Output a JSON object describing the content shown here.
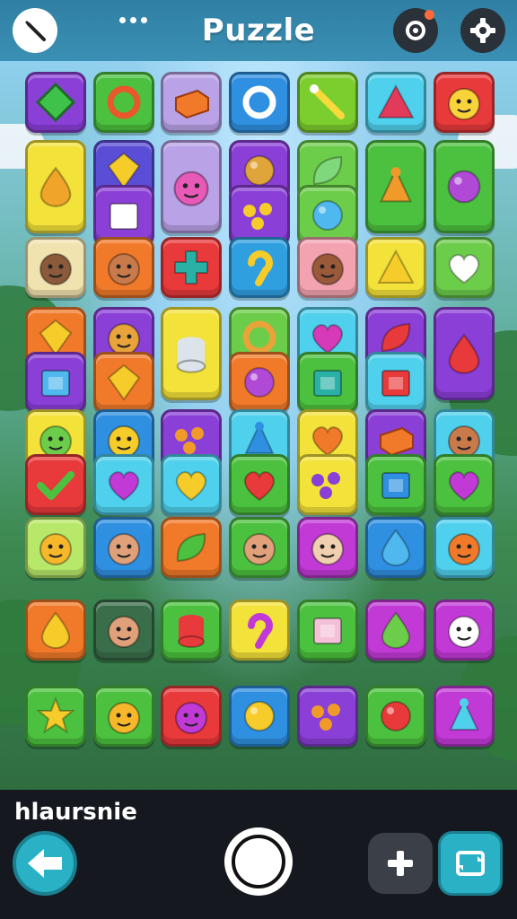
{
  "app": {
    "title": "Puzzle",
    "status_text": "hlaursnie"
  },
  "colors": {
    "topbar": "#3a90b4",
    "bottombar": "#15191f",
    "accent": "#2ab1c6"
  },
  "toolbar": {
    "back_icon": "wrench-icon",
    "menu_icon": "dots-icon",
    "badge_icon": "gear-badge-icon",
    "settings_icon": "gear-icon"
  },
  "controls": {
    "back_icon": "arrow-left-icon",
    "center_icon": "circle-icon",
    "add_icon": "plus-icon",
    "shuffle_icon": "shuffle-icon"
  },
  "tiles": [
    {
      "name": "kite-tile",
      "color": "#8a3fd6",
      "icon": "kite",
      "fg": "#3fc24a"
    },
    {
      "name": "ring-tile",
      "color": "#4cc13f",
      "icon": "ring",
      "fg": "#e8582a"
    },
    {
      "name": "brick-tile",
      "color": "#b9a2e6",
      "icon": "brick",
      "fg": "#f07a2a"
    },
    {
      "name": "magnifier-tile",
      "color": "#2f8fe0",
      "icon": "ring",
      "fg": "#ffffff"
    },
    {
      "name": "wand-tile",
      "color": "#7ccd2e",
      "icon": "wand",
      "fg": "#f6d93a"
    },
    {
      "name": "pyramid-tile",
      "color": "#4fd0ec",
      "icon": "triangle",
      "fg": "#e23a5a"
    },
    {
      "name": "bear-tile",
      "color": "#e8393b",
      "icon": "face",
      "fg": "#f9d33a"
    },
    {
      "name": "squid-tile",
      "color": "#f3e23a",
      "icon": "drop",
      "fg": "#f0a52a"
    },
    {
      "name": "gem-tile",
      "color": "#5a4ed6",
      "icon": "diamond",
      "fg": "#f6cc2a"
    },
    {
      "name": "cube-tile",
      "color": "#8a3fd6",
      "icon": "cube",
      "fg": "#ffffff"
    },
    {
      "name": "cat-tile",
      "color": "#b9a2e6",
      "icon": "face",
      "fg": "#e85ab8"
    },
    {
      "name": "cookie-tile",
      "color": "#8a3fd6",
      "icon": "circle",
      "fg": "#e0a53a"
    },
    {
      "name": "rings-tile",
      "color": "#8a3fd6",
      "icon": "dots",
      "fg": "#f6cc2a"
    },
    {
      "name": "leaf-tile",
      "color": "#6ccd4a",
      "icon": "leaf",
      "fg": "#7fd87a"
    },
    {
      "name": "balloon-tile",
      "color": "#6ccd4a",
      "icon": "circle",
      "fg": "#4fb8ee"
    },
    {
      "name": "rocket-tile",
      "color": "#4cc13f",
      "icon": "cone",
      "fg": "#f09a2a"
    },
    {
      "name": "lollipop-tile",
      "color": "#4cc13f",
      "icon": "circle",
      "fg": "#b04ad6"
    },
    {
      "name": "hat-face-tile",
      "color": "#f1e3b0",
      "icon": "face",
      "fg": "#8a5a3a"
    },
    {
      "name": "boy-face-tile",
      "color": "#f07a2a",
      "icon": "face",
      "fg": "#c97a4a"
    },
    {
      "name": "cross-tile",
      "color": "#e8393b",
      "icon": "cross",
      "fg": "#2ab1a6"
    },
    {
      "name": "hook-tile",
      "color": "#2f9fe0",
      "icon": "hook",
      "fg": "#f6cc2a"
    },
    {
      "name": "girl-face-tile",
      "color": "#f3a3b0",
      "icon": "face",
      "fg": "#9a5a3a"
    },
    {
      "name": "cheese-tile",
      "color": "#f3e23a",
      "icon": "triangle",
      "fg": "#f6cc2a"
    },
    {
      "name": "heart-white-tile",
      "color": "#6ccd4a",
      "icon": "heart",
      "fg": "#ffffff"
    },
    {
      "name": "gold-gem-tile",
      "color": "#f07a2a",
      "icon": "diamond",
      "fg": "#f6cc2a"
    },
    {
      "name": "mask-tile",
      "color": "#8a3fd6",
      "icon": "face",
      "fg": "#e8a33a"
    },
    {
      "name": "paper-tile",
      "color": "#f3e23a",
      "icon": "cylinder",
      "fg": "#dde3ea"
    },
    {
      "name": "swirl-tile",
      "color": "#6ccd4a",
      "icon": "ring",
      "fg": "#e8a33a"
    },
    {
      "name": "apple-tile",
      "color": "#4fd0ec",
      "icon": "heart",
      "fg": "#d63ab8"
    },
    {
      "name": "leaves-tile",
      "color": "#8a3fd6",
      "icon": "leaf",
      "fg": "#e8393b"
    },
    {
      "name": "chili-tile",
      "color": "#8a3fd6",
      "icon": "drop",
      "fg": "#e8393b"
    },
    {
      "name": "box-tile",
      "color": "#8a3fd6",
      "icon": "cube",
      "fg": "#4fb8ee"
    },
    {
      "name": "waffle-tile",
      "color": "#f07a2a",
      "icon": "diamond",
      "fg": "#f6cc2a"
    },
    {
      "name": "eggplant-tile",
      "color": "#f07a2a",
      "icon": "circle",
      "fg": "#b04ad6"
    },
    {
      "name": "crate-tile",
      "color": "#4cc13f",
      "icon": "cube",
      "fg": "#2ab1a6"
    },
    {
      "name": "red-box-tile",
      "color": "#4fd0ec",
      "icon": "cube",
      "fg": "#e8393b"
    },
    {
      "name": "frog-tile",
      "color": "#f3e23a",
      "icon": "face",
      "fg": "#6ccd4a"
    },
    {
      "name": "hat-kid-tile",
      "color": "#2f8fe0",
      "icon": "face",
      "fg": "#f6cc2a"
    },
    {
      "name": "berries-tile",
      "color": "#8a3fd6",
      "icon": "dots",
      "fg": "#f09a2a"
    },
    {
      "name": "bell-tile",
      "color": "#4fd0ec",
      "icon": "cone",
      "fg": "#2f8fe0"
    },
    {
      "name": "orange-heart-tile",
      "color": "#f3e23a",
      "icon": "heart",
      "fg": "#f07a2a"
    },
    {
      "name": "block-tile",
      "color": "#8a3fd6",
      "icon": "brick",
      "fg": "#f07a2a"
    },
    {
      "name": "beret-tile",
      "color": "#4fd0ec",
      "icon": "face",
      "fg": "#c97a4a"
    },
    {
      "name": "check-tile",
      "color": "#e8393b",
      "icon": "check",
      "fg": "#4cc13f"
    },
    {
      "name": "purple-heart-tile",
      "color": "#4fd0ec",
      "icon": "heart",
      "fg": "#c23ad6"
    },
    {
      "name": "yellow-heart-tile",
      "color": "#4fd0ec",
      "icon": "heart",
      "fg": "#f6cc2a"
    },
    {
      "name": "red-heart-tile",
      "color": "#4cc13f",
      "icon": "heart",
      "fg": "#e8393b"
    },
    {
      "name": "scissors-tile",
      "color": "#f3e23a",
      "icon": "dots",
      "fg": "#8a3fd6"
    },
    {
      "name": "tag-tile",
      "color": "#4cc13f",
      "icon": "cube",
      "fg": "#2f8fe0"
    },
    {
      "name": "violet-heart-tile",
      "color": "#4cc13f",
      "icon": "heart",
      "fg": "#c23ad6"
    },
    {
      "name": "sun-face-tile",
      "color": "#b8e86a",
      "icon": "face",
      "fg": "#f6b82a"
    },
    {
      "name": "cap-boy-tile",
      "color": "#2f8fe0",
      "icon": "face",
      "fg": "#e0a07a"
    },
    {
      "name": "pepper-tile",
      "color": "#f07a2a",
      "icon": "leaf",
      "fg": "#4cc13f"
    },
    {
      "name": "green-cap-tile",
      "color": "#4cc13f",
      "icon": "face",
      "fg": "#e0a07a"
    },
    {
      "name": "red-hat-tile",
      "color": "#c23ad6",
      "icon": "face",
      "fg": "#f1d0b0"
    },
    {
      "name": "blue-drop-tile",
      "color": "#2f8fe0",
      "icon": "drop",
      "fg": "#4fb8ee"
    },
    {
      "name": "pumpkin-tile",
      "color": "#4fd0ec",
      "icon": "face",
      "fg": "#f07a2a"
    },
    {
      "name": "fire-tile",
      "color": "#f07a2a",
      "icon": "drop",
      "fg": "#f6cc2a"
    },
    {
      "name": "purple-cap-tile",
      "color": "#3a6e4a",
      "icon": "face",
      "fg": "#e0a07a"
    },
    {
      "name": "lantern-tile",
      "color": "#4cc13f",
      "icon": "cylinder",
      "fg": "#e8393b"
    },
    {
      "name": "purple-hook-tile",
      "color": "#f3e23a",
      "icon": "hook",
      "fg": "#c23ad6"
    },
    {
      "name": "house-tile",
      "color": "#4cc13f",
      "icon": "cube",
      "fg": "#f3c0d8"
    },
    {
      "name": "pear-tile",
      "color": "#c23ad6",
      "icon": "drop",
      "fg": "#6ccd4a"
    },
    {
      "name": "ghost-tile",
      "color": "#c23ad6",
      "icon": "face",
      "fg": "#ffffff"
    },
    {
      "name": "star-tile",
      "color": "#4cc13f",
      "icon": "star",
      "fg": "#f6cc2a"
    },
    {
      "name": "fox-tile",
      "color": "#4cc13f",
      "icon": "face",
      "fg": "#f6b82a"
    },
    {
      "name": "pink-cat-tile",
      "color": "#e8393b",
      "icon": "face",
      "fg": "#c23ad6"
    },
    {
      "name": "coin-tile",
      "color": "#2f8fe0",
      "icon": "circle",
      "fg": "#f6cc2a"
    },
    {
      "name": "beads-tile",
      "color": "#8a3fd6",
      "icon": "dots",
      "fg": "#f09a2a"
    },
    {
      "name": "cherry-tile",
      "color": "#4cc13f",
      "icon": "circle",
      "fg": "#e8393b"
    },
    {
      "name": "bulb-tile",
      "color": "#c23ad6",
      "icon": "cone",
      "fg": "#4fd0ec"
    },
    {
      "name": "carrot-tile",
      "color": "#4cc13f",
      "icon": "drop",
      "fg": "#f07a2a"
    }
  ]
}
